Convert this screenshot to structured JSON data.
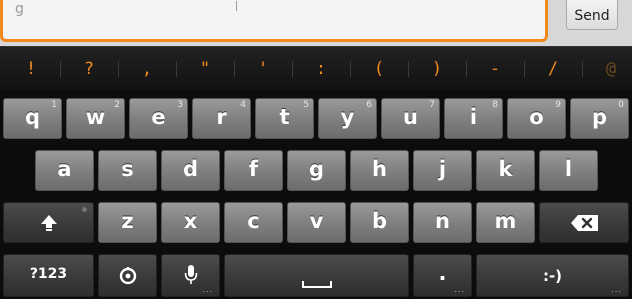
{
  "compose": {
    "hint_text": "g",
    "send_label": "Send"
  },
  "symbols": [
    "!",
    "?",
    ",",
    "\"",
    "'",
    ":",
    "(",
    ")",
    "-",
    "/",
    "@"
  ],
  "rows": {
    "row1": [
      {
        "label": "q",
        "sub": "1"
      },
      {
        "label": "w",
        "sub": "2"
      },
      {
        "label": "e",
        "sub": "3"
      },
      {
        "label": "r",
        "sub": "4"
      },
      {
        "label": "t",
        "sub": "5"
      },
      {
        "label": "y",
        "sub": "6"
      },
      {
        "label": "u",
        "sub": "7"
      },
      {
        "label": "i",
        "sub": "8"
      },
      {
        "label": "o",
        "sub": "9"
      },
      {
        "label": "p",
        "sub": "0"
      }
    ],
    "row2": [
      "a",
      "s",
      "d",
      "f",
      "g",
      "h",
      "j",
      "k",
      "l"
    ],
    "row3": [
      "z",
      "x",
      "c",
      "v",
      "b",
      "n",
      "m"
    ],
    "row4": {
      "numbers_label": "?123",
      "period_label": ".",
      "smiley_label": ":-)"
    }
  },
  "icons": {
    "shift": "shift-arrow-icon",
    "backspace": "backspace-icon",
    "settings": "settings-gear-icon",
    "mic": "microphone-icon",
    "space": "spacebar-icon"
  },
  "colors": {
    "accent": "#f08a1c",
    "key_light": "#8a8a8a",
    "key_dark": "#3a3a3a",
    "background": "#0c0c0c"
  }
}
